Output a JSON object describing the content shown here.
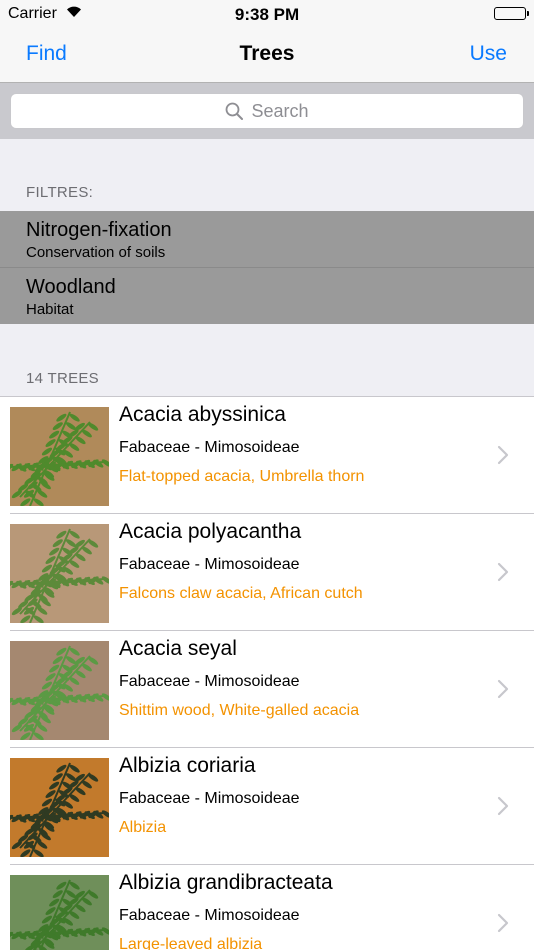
{
  "status": {
    "carrier": "Carrier",
    "time": "9:38 PM",
    "battery_level": 1.0
  },
  "nav": {
    "left": "Find",
    "title": "Trees",
    "right": "Use"
  },
  "search": {
    "placeholder": "Search"
  },
  "filters": {
    "header": "FILTRES:",
    "items": [
      {
        "title": "Nitrogen-fixation",
        "subtitle": "Conservation of soils"
      },
      {
        "title": "Woodland",
        "subtitle": "Habitat"
      }
    ]
  },
  "trees": {
    "header": "14 TREES",
    "items": [
      {
        "name": "Acacia abyssinica",
        "family": "Fabaceae - Mimosoideae",
        "common": "Flat-topped acacia, Umbrella thorn",
        "bg": "#b08a5a",
        "leaf": "#4f8a2c"
      },
      {
        "name": "Acacia polyacantha",
        "family": "Fabaceae - Mimosoideae",
        "common": "Falcons claw acacia, African cutch",
        "bg": "#b89878",
        "leaf": "#5c8a3a"
      },
      {
        "name": "Acacia seyal",
        "family": "Fabaceae - Mimosoideae",
        "common": "Shittim wood, White-galled acacia",
        "bg": "#a58870",
        "leaf": "#5b9a44"
      },
      {
        "name": "Albizia coriaria",
        "family": "Fabaceae - Mimosoideae",
        "common": "Albizia",
        "bg": "#c27a2c",
        "leaf": "#2f3a22"
      },
      {
        "name": "Albizia grandibracteata",
        "family": "Fabaceae - Mimosoideae",
        "common": "Large-leaved albizia",
        "bg": "#6f8f5a",
        "leaf": "#3f7a2a"
      }
    ]
  }
}
